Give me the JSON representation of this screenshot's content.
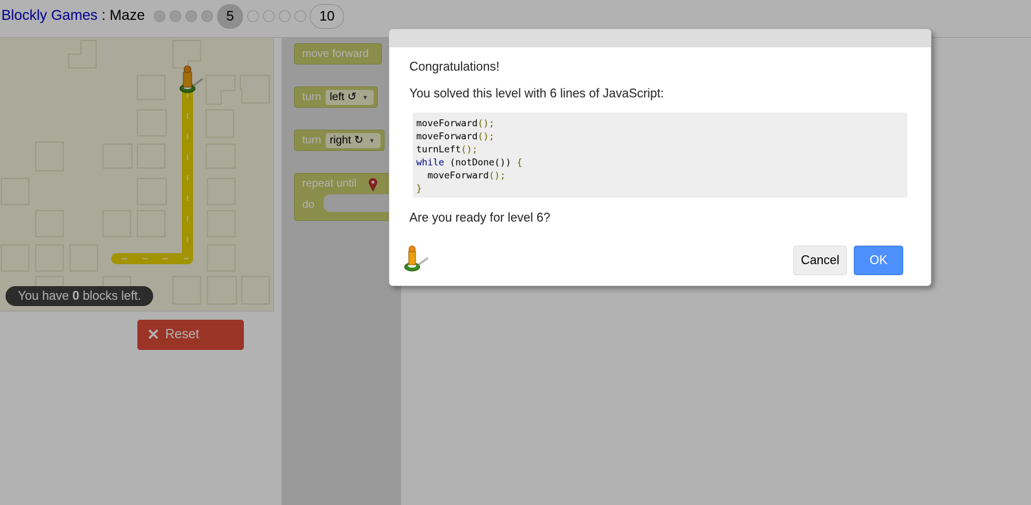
{
  "header": {
    "app_name": "Blockly Games",
    "separator": " : ",
    "game_name": "Maze",
    "current_level": "5",
    "last_level": "10",
    "completed_levels": 4,
    "remaining_dots": 4
  },
  "maze": {
    "capacity_prefix": "You have ",
    "capacity_count": "0",
    "capacity_suffix": " blocks left.",
    "reset_label": "Reset",
    "reset_icon": "x-icon",
    "colors": {
      "path": "#e8d300",
      "background": "#f5f2dd",
      "reset": "#dd4b39"
    }
  },
  "toolbox": {
    "move_forward": "move forward",
    "turn": "turn",
    "left_option": "left ↺",
    "right_option": "right ↻",
    "repeat_until": "repeat until",
    "do": "do",
    "marker_icon": "map-marker-icon"
  },
  "dialog": {
    "congrats": "Congratulations!",
    "solved_text": "You solved this level with 6 lines of JavaScript:",
    "code": [
      {
        "kw": "",
        "text": "moveForward",
        "pun": "();"
      },
      {
        "kw": "",
        "text": "moveForward",
        "pun": "();"
      },
      {
        "kw": "",
        "text": "turnLeft",
        "pun": "();"
      },
      {
        "kw": "while",
        "text": " (notDone()) ",
        "pun": "{"
      },
      {
        "kw": "",
        "text": "  moveForward",
        "pun": "();"
      },
      {
        "kw": "",
        "text": "",
        "pun": "}"
      }
    ],
    "ready_text": "Are you ready for level 6?",
    "cancel_label": "Cancel",
    "ok_label": "OK",
    "colors": {
      "ok": "#4d90fe"
    }
  }
}
